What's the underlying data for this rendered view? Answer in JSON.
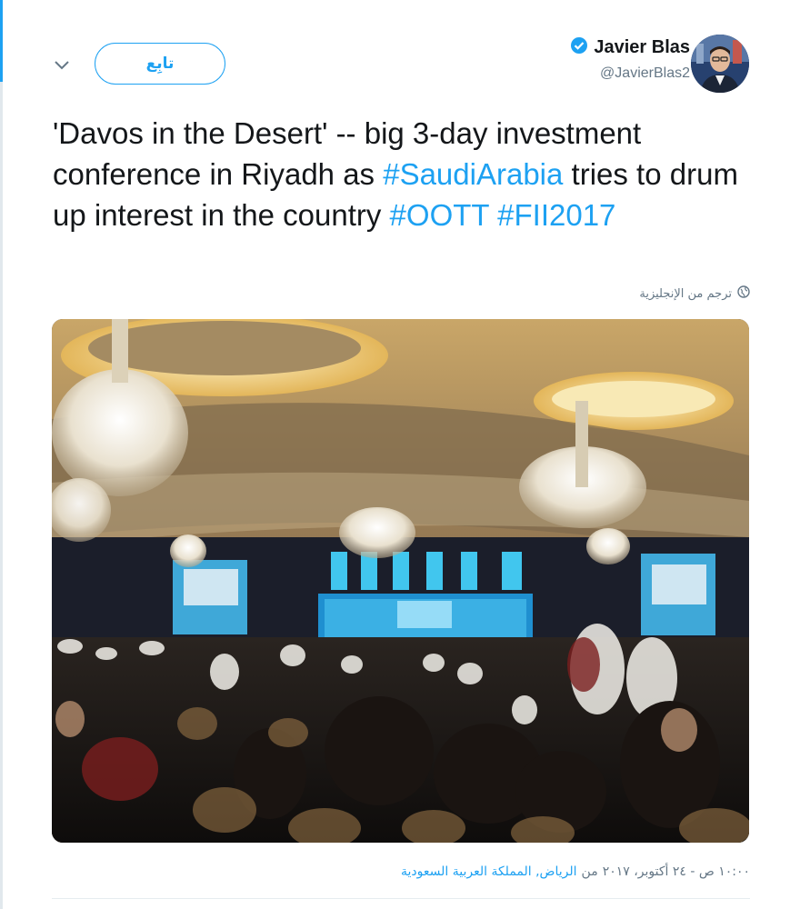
{
  "header": {
    "follow_label": "تابِع",
    "display_name": "Javier Blas",
    "handle": "@JavierBlas2",
    "icons": {
      "menu": "chevron-down-icon",
      "verified": "verified-badge-icon"
    }
  },
  "tweet": {
    "segments": [
      {
        "text": "'Davos in the Desert' -- big 3-day investment conference in Riyadh as ",
        "type": "text"
      },
      {
        "text": "#SaudiArabia",
        "type": "hashtag"
      },
      {
        "text": " tries to drum up interest in the country ",
        "type": "text"
      },
      {
        "text": "#OOTT",
        "type": "hashtag"
      },
      {
        "text": " ",
        "type": "text"
      },
      {
        "text": "#FII2017",
        "type": "hashtag"
      }
    ],
    "translate_label": "ترجم من الإنجليزية",
    "time": "١٠:٠٠ ص - ٢٤ أكتوبر، ٢٠١٧",
    "from": "من",
    "location": "الرياض, المملكة العربية السعودية"
  },
  "colors": {
    "accent": "#1da1f2",
    "text": "#14171a",
    "muted": "#657786"
  }
}
